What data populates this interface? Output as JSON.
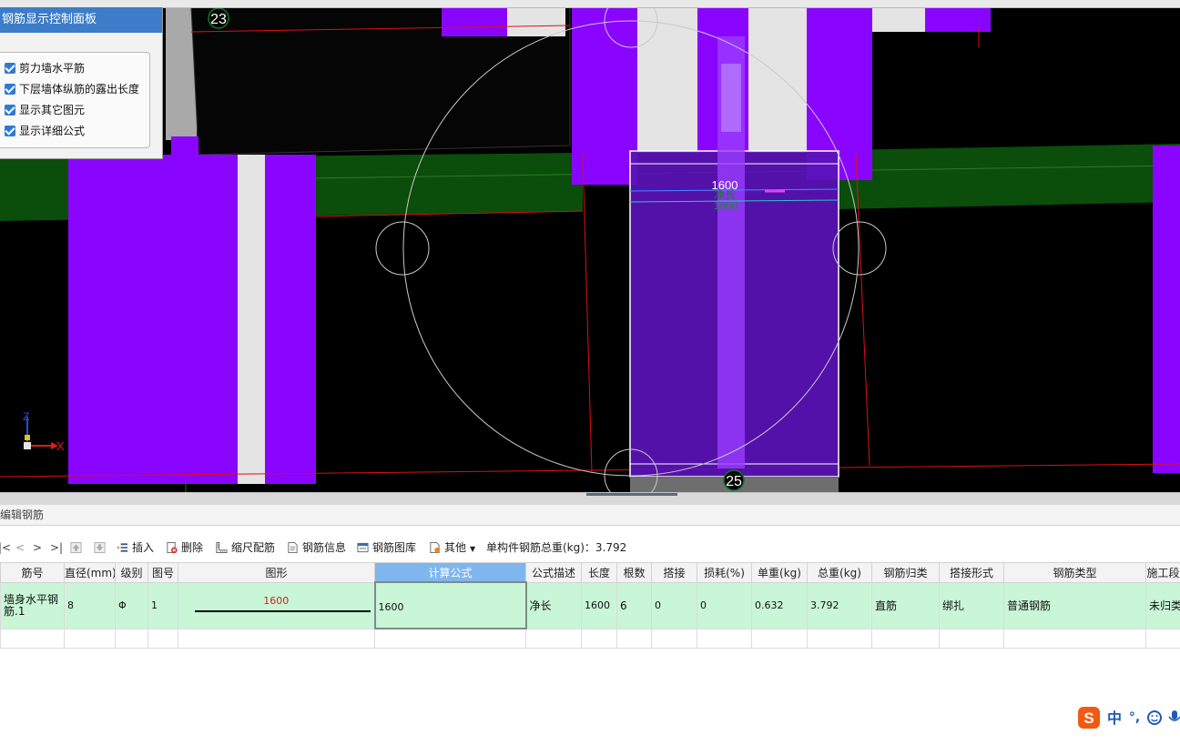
{
  "viewport": {
    "grid_labels": [
      "23",
      "25"
    ],
    "dim_text_top": "1600",
    "dim_text_mid": "净长",
    "dim_text_bottom": "1600",
    "axis_x": "X",
    "axis_z": "Z"
  },
  "control_panel": {
    "title": "钢筋显示控制面板",
    "options": [
      {
        "label": "剪力墙水平筋",
        "checked": true
      },
      {
        "label": "下层墙体纵筋的露出长度",
        "checked": true
      },
      {
        "label": "显示其它图元",
        "checked": true
      },
      {
        "label": "显示详细公式",
        "checked": true
      }
    ]
  },
  "section_title": "编辑钢筋",
  "toolbar": {
    "nav_first": "|<",
    "nav_prev": "<",
    "nav_next": ">",
    "nav_last": ">|",
    "insert": "插入",
    "delete": "删除",
    "ruler": "缩尺配筋",
    "rebar_info": "钢筋信息",
    "rebar_library": "钢筋图库",
    "other": "其他",
    "total_weight": "单构件钢筋总重(kg)：3.792"
  },
  "table": {
    "columns": [
      "筋号",
      "直径(mm)",
      "级别",
      "图号",
      "图形",
      "计算公式",
      "公式描述",
      "长度",
      "根数",
      "搭接",
      "损耗(%)",
      "单重(kg)",
      "总重(kg)",
      "钢筋归类",
      "搭接形式",
      "钢筋类型",
      "施工段"
    ],
    "rows": [
      {
        "bar_name": "墙身水平钢筋.1",
        "diameter": "8",
        "grade": "Φ",
        "figure_no": "1",
        "shape_value": "1600",
        "formula": "1600",
        "formula_desc": "净长",
        "length": "1600",
        "count": "6",
        "lap": "0",
        "loss": "0",
        "unit_weight": "0.632",
        "total_weight": "3.792",
        "category": "直筋",
        "lap_type": "绑扎",
        "rebar_type": "普通钢筋",
        "stage": "未归类"
      }
    ]
  },
  "ime": {
    "logo": "S",
    "lang": "中",
    "punct": "°,"
  },
  "colors": {
    "wall_purple": "#8800ff",
    "beam_green": "#0b5a0b",
    "selected_header": "#7fb6ee",
    "row_highlight": "#c9f6d6",
    "panel_title": "#3c7cc8"
  }
}
